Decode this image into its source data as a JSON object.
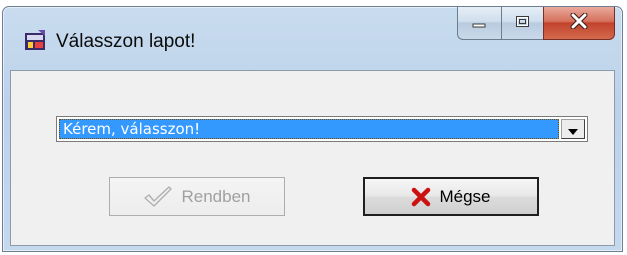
{
  "window": {
    "title": "Válasszon lapot!",
    "controls": [
      "minimize-icon",
      "maximize-icon",
      "close-icon"
    ]
  },
  "combo": {
    "selected": "Kérem, válasszon!"
  },
  "buttons": {
    "ok_label": "Rendben",
    "ok_enabled": false,
    "ok_icon": "checkmark-icon",
    "cancel_label": "Mégse",
    "cancel_icon": "red-x-icon"
  },
  "colors": {
    "selection": "#3399ff",
    "close_button": "#c2432c",
    "cancel_x": "#cc1111"
  }
}
